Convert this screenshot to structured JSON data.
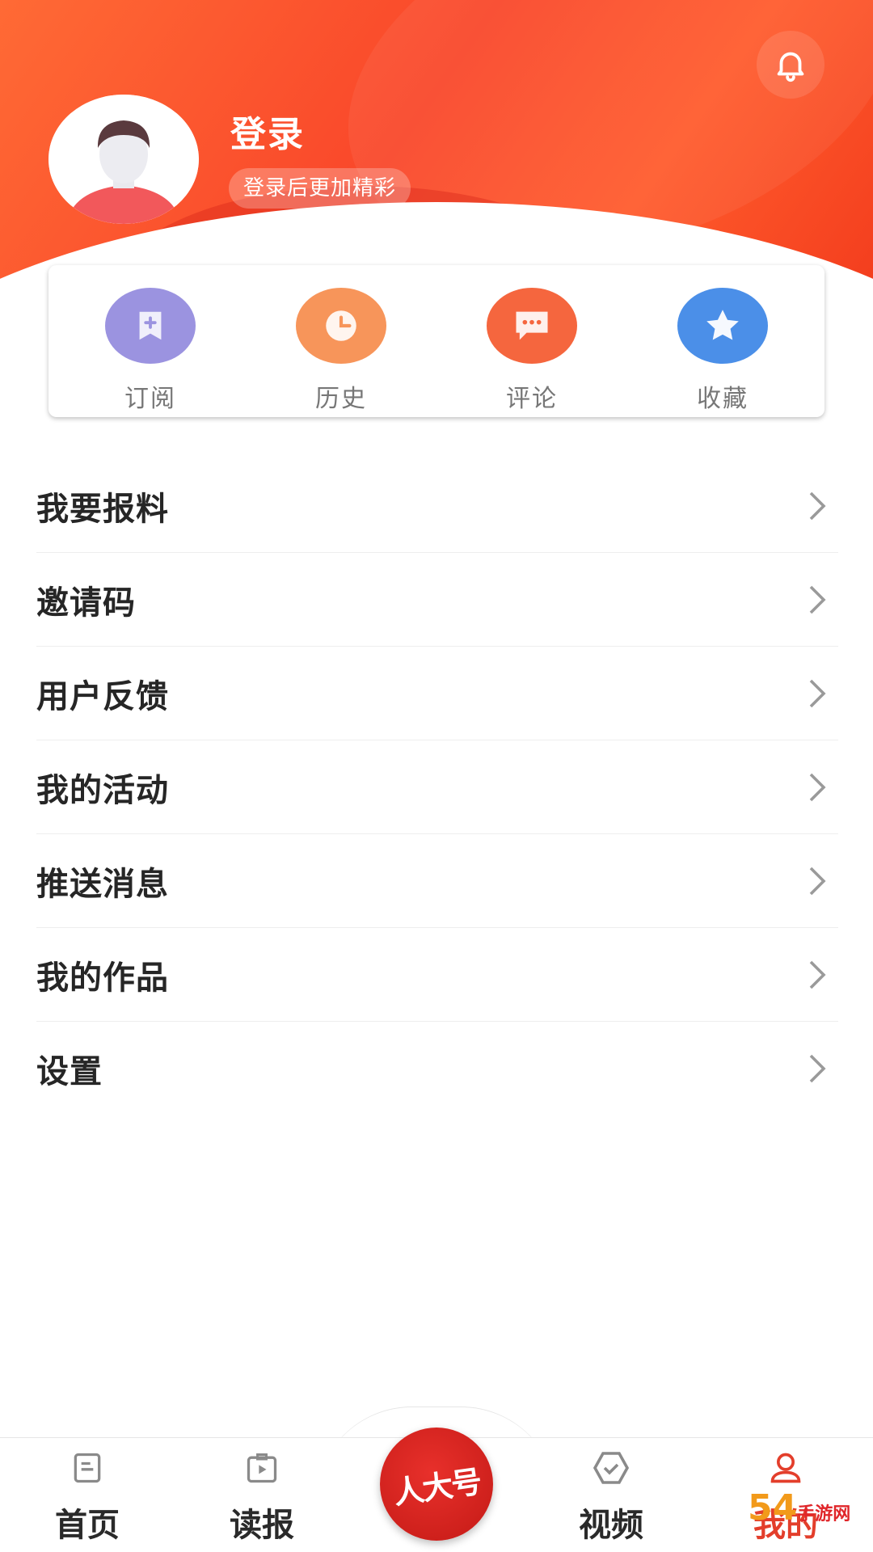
{
  "header": {
    "title": "登录",
    "subtitle": "登录后更加精彩",
    "bell_icon": "bell-icon"
  },
  "quick_actions": [
    {
      "label": "订阅",
      "icon": "subscribe-bookmark-icon",
      "color": "#9b93e0"
    },
    {
      "label": "历史",
      "icon": "clock-icon",
      "color": "#f7955a"
    },
    {
      "label": "评论",
      "icon": "comment-icon",
      "color": "#f5663e"
    },
    {
      "label": "收藏",
      "icon": "star-icon",
      "color": "#4b8fe8"
    }
  ],
  "menu": [
    {
      "label": "我要报料"
    },
    {
      "label": "邀请码"
    },
    {
      "label": "用户反馈"
    },
    {
      "label": "我的活动"
    },
    {
      "label": "推送消息"
    },
    {
      "label": "我的作品"
    },
    {
      "label": "设置"
    }
  ],
  "nav": {
    "home": "首页",
    "paper": "读报",
    "center": "人大号",
    "video": "视频",
    "mine": "我的",
    "active_color": "#e33e2b"
  },
  "watermark": {
    "big": "54",
    "small": "手游网"
  }
}
